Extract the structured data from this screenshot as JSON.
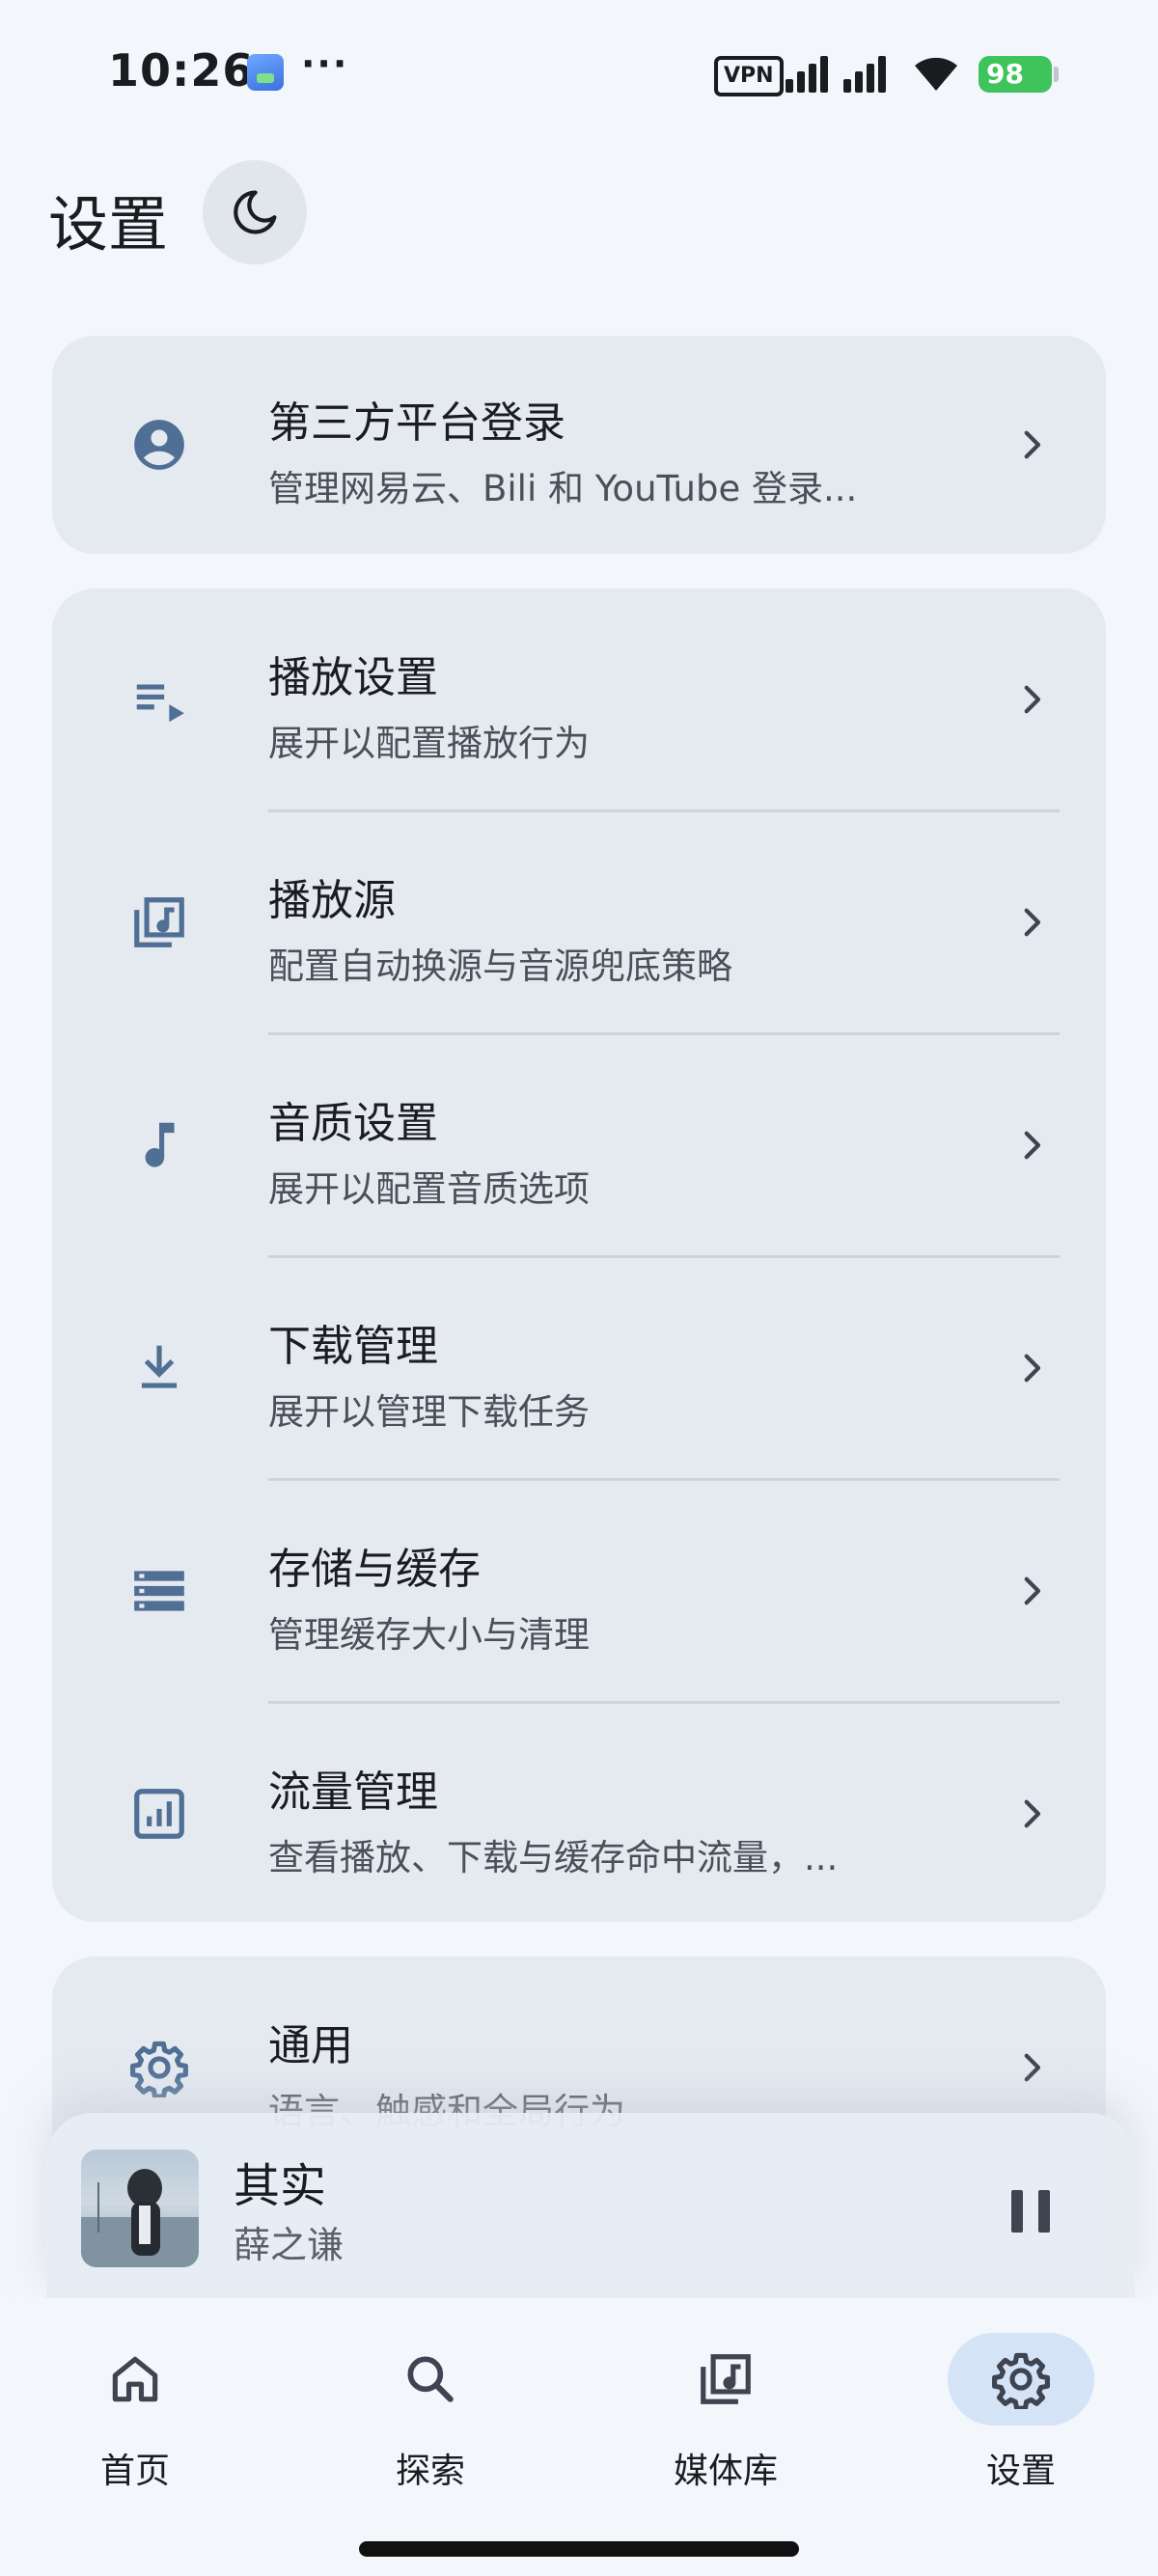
{
  "status_bar": {
    "time": "10:26",
    "more": "···",
    "vpn": "VPN",
    "battery": "98"
  },
  "header": {
    "title": "设置",
    "theme_icon": "moon-icon"
  },
  "cards": {
    "account": {
      "title": "第三方平台登录",
      "subtitle": "管理网易云、Bili 和 YouTube 登录...",
      "icon": "account-circle-icon"
    },
    "settings": [
      {
        "title": "播放设置",
        "subtitle": "展开以配置播放行为",
        "icon": "playlist-play-icon"
      },
      {
        "title": "播放源",
        "subtitle": "配置自动换源与音源兜底策略",
        "icon": "library-music-icon"
      },
      {
        "title": "音质设置",
        "subtitle": "展开以配置音质选项",
        "icon": "music-note-icon"
      },
      {
        "title": "下载管理",
        "subtitle": "展开以管理下载任务",
        "icon": "download-icon"
      },
      {
        "title": "存储与缓存",
        "subtitle": "管理缓存大小与清理",
        "icon": "storage-icon"
      },
      {
        "title": "流量管理",
        "subtitle": "查看播放、下载与缓存命中流量，...",
        "icon": "data-usage-icon"
      }
    ],
    "general": {
      "title": "通用",
      "subtitle": "语言、触感和全局行为",
      "icon": "gear-icon"
    }
  },
  "mini_player": {
    "title": "其实",
    "artist": "薛之谦",
    "playing": true
  },
  "bottom_nav": [
    {
      "label": "首页",
      "icon": "home-icon"
    },
    {
      "label": "探索",
      "icon": "search-icon"
    },
    {
      "label": "媒体库",
      "icon": "library-music-icon"
    },
    {
      "label": "设置",
      "icon": "gear-icon",
      "active": true
    }
  ],
  "colors": {
    "background": "#f3f6fb",
    "card": "#e5e9f0",
    "icon_accent": "#4f6f94",
    "active_nav": "#d4e3f6",
    "battery": "#3fc35b"
  }
}
